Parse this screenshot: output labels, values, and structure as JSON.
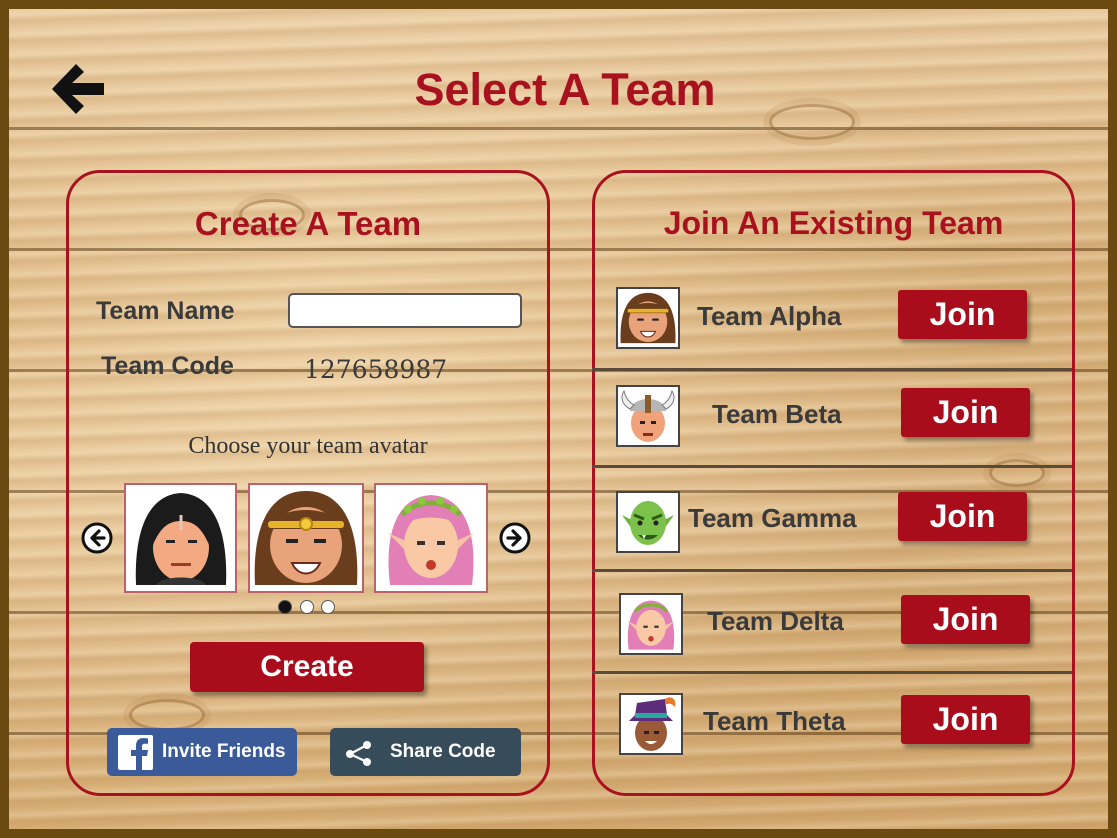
{
  "page": {
    "title": "Select A Team"
  },
  "create_panel": {
    "title": "Create A Team",
    "team_name_label": "Team Name",
    "team_name_value": "",
    "team_code_label": "Team Code",
    "team_code_value": "127658987",
    "avatar_prompt": "Choose your team avatar",
    "avatars": [
      "hooded-avatar",
      "headband-avatar",
      "elf-avatar"
    ],
    "carousel_page": 1,
    "carousel_pages": 3,
    "create_label": "Create",
    "invite_label": "Invite Friends",
    "share_label": "Share Code"
  },
  "join_panel": {
    "title": "Join An Existing Team",
    "join_label": "Join",
    "teams": [
      {
        "name": "Team Alpha",
        "avatar": "headband-avatar"
      },
      {
        "name": "Team Beta",
        "avatar": "viking-avatar"
      },
      {
        "name": "Team Gamma",
        "avatar": "goblin-avatar"
      },
      {
        "name": "Team Delta",
        "avatar": "elf-avatar"
      },
      {
        "name": "Team Theta",
        "avatar": "wizard-hat-avatar"
      }
    ]
  },
  "colors": {
    "accent": "#a8121f",
    "button": "#a90d1b",
    "facebook": "#3b5a9a",
    "share": "#364c5a",
    "frame": "#6b4a12"
  }
}
